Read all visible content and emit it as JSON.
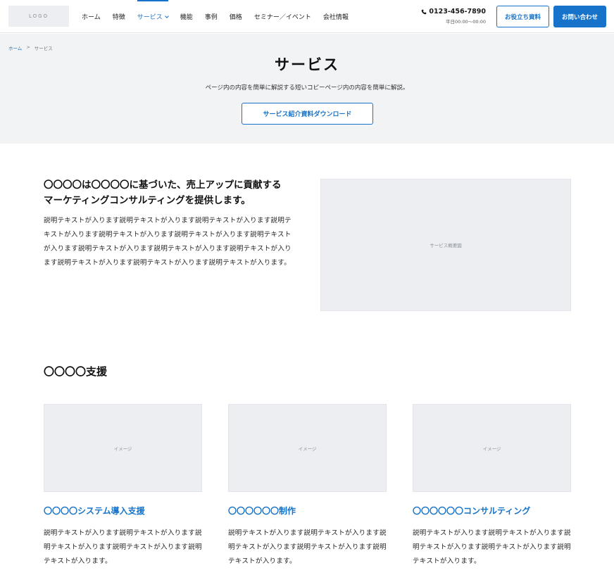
{
  "header": {
    "logo": "LOGO",
    "nav": [
      {
        "label": "ホーム",
        "active": false
      },
      {
        "label": "特徴",
        "active": false
      },
      {
        "label": "サービス",
        "active": true
      },
      {
        "label": "機能",
        "active": false
      },
      {
        "label": "事例",
        "active": false
      },
      {
        "label": "価格",
        "active": false
      },
      {
        "label": "セミナー／イベント",
        "active": false
      },
      {
        "label": "会社情報",
        "active": false
      }
    ],
    "phone_number": "0123-456-7890",
    "phone_hours": "平日00:00〜00:00",
    "docs_button": "お役立ち資料",
    "contact_button": "お問い合わせ"
  },
  "hero": {
    "breadcrumb_home": "ホーム",
    "breadcrumb_sep": ">",
    "breadcrumb_current": "サービス",
    "title": "サービス",
    "lead": "ページ内の内容を簡単に解説する短いコピーページ内の内容を簡単に解説。",
    "download_button": "サービス紹介資料ダウンロード"
  },
  "intro": {
    "heading_line1": "〇〇〇〇は〇〇〇〇に基づいた、売上アップに貢献する",
    "heading_line2": "マーケティングコンサルティングを提供します。",
    "body": "説明テキストが入ります説明テキストが入ります説明テキストが入ります説明テキストが入ります説明テキストが入ります説明テキストが入ります説明テキストが入ります説明テキストが入ります説明テキストが入ります説明テキストが入ります説明テキストが入ります説明テキストが入ります説明テキストが入ります。",
    "image_label": "サービス概要図"
  },
  "support": {
    "title": "〇〇〇〇支援",
    "cards": [
      {
        "image_label": "イメージ",
        "title": "〇〇〇〇システム導入支援",
        "body": "説明テキストが入ります説明テキストが入ります説明テキストが入ります説明テキストが入ります説明テキストが入ります。"
      },
      {
        "image_label": "イメージ",
        "title": "〇〇〇〇〇〇制作",
        "body": "説明テキストが入ります説明テキストが入ります説明テキストが入ります説明テキストが入ります説明テキストが入ります。"
      },
      {
        "image_label": "イメージ",
        "title": "〇〇〇〇〇〇コンサルティング",
        "body": "説明テキストが入ります説明テキストが入ります説明テキストが入ります説明テキストが入ります説明テキストが入ります。"
      }
    ]
  },
  "colors": {
    "accent": "#1673c9",
    "hero_bg": "#f2f3f5",
    "placeholder_bg": "#eceef1"
  },
  "icons": {
    "phone": "phone-icon",
    "chevron": "chevron-down-icon"
  }
}
